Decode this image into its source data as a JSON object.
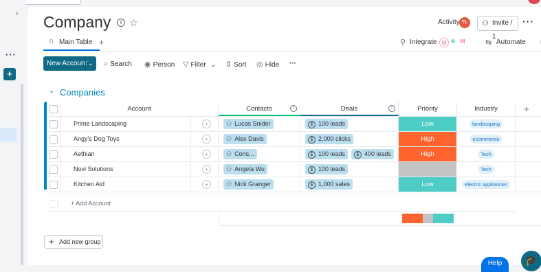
{
  "header": {
    "title": "Company",
    "activity_label": "Activity",
    "avatar_initials": "TL",
    "invite_label": "Invite / 1"
  },
  "tabs": {
    "main_label": "Main Table",
    "add_label": "+",
    "integrate_label": "Integrate",
    "automate_label": "Automate"
  },
  "toolbar": {
    "new_label": "New Account",
    "search_label": "Search",
    "person_label": "Person",
    "filter_label": "Filter",
    "sort_label": "Sort",
    "hide_label": "Hide"
  },
  "group": {
    "name": "Companies",
    "color": "#0086c0",
    "columns": {
      "account": "Account",
      "contacts": "Contacts",
      "deals": "Deals",
      "priority": "Priority",
      "industry": "Industry"
    },
    "add_item": "+ Add Account",
    "rows": [
      {
        "account": "Prime Landscaping",
        "contacts": [
          "Lucas Snider"
        ],
        "deals": [
          "100 leads"
        ],
        "priority": "Low",
        "priority_color": "#4eccc6",
        "industry": "landscaping"
      },
      {
        "account": "Angy's Dog Toys",
        "contacts": [
          "Alex Davis"
        ],
        "deals": [
          "2,000 clicks"
        ],
        "priority": "High",
        "priority_color": "#ff642e",
        "industry": "ecommerce"
      },
      {
        "account": "Aethian",
        "contacts": [
          "Cons..."
        ],
        "deals": [
          "100 leads",
          "400 leads"
        ],
        "priority": "High",
        "priority_color": "#ff642e",
        "industry": "Tech"
      },
      {
        "account": "Novi Solutions",
        "contacts": [
          "Angela Wu"
        ],
        "deals": [
          "100 leads"
        ],
        "priority": "",
        "priority_color": "#c4c4c4",
        "industry": "Tech"
      },
      {
        "account": "Kitchen Aid",
        "contacts": [
          "Nick Granger"
        ],
        "deals": [
          "1,000 sales"
        ],
        "priority": "Low",
        "priority_color": "#4eccc6",
        "industry": "electric appliances"
      }
    ],
    "priority_summary": [
      {
        "fraction": 0.4,
        "color": "#ff642e"
      },
      {
        "fraction": 0.2,
        "color": "#c4c4c4"
      },
      {
        "fraction": 0.4,
        "color": "#4eccc6"
      }
    ]
  },
  "footer": {
    "add_group_label": "Add new group",
    "help_label": "Help"
  }
}
